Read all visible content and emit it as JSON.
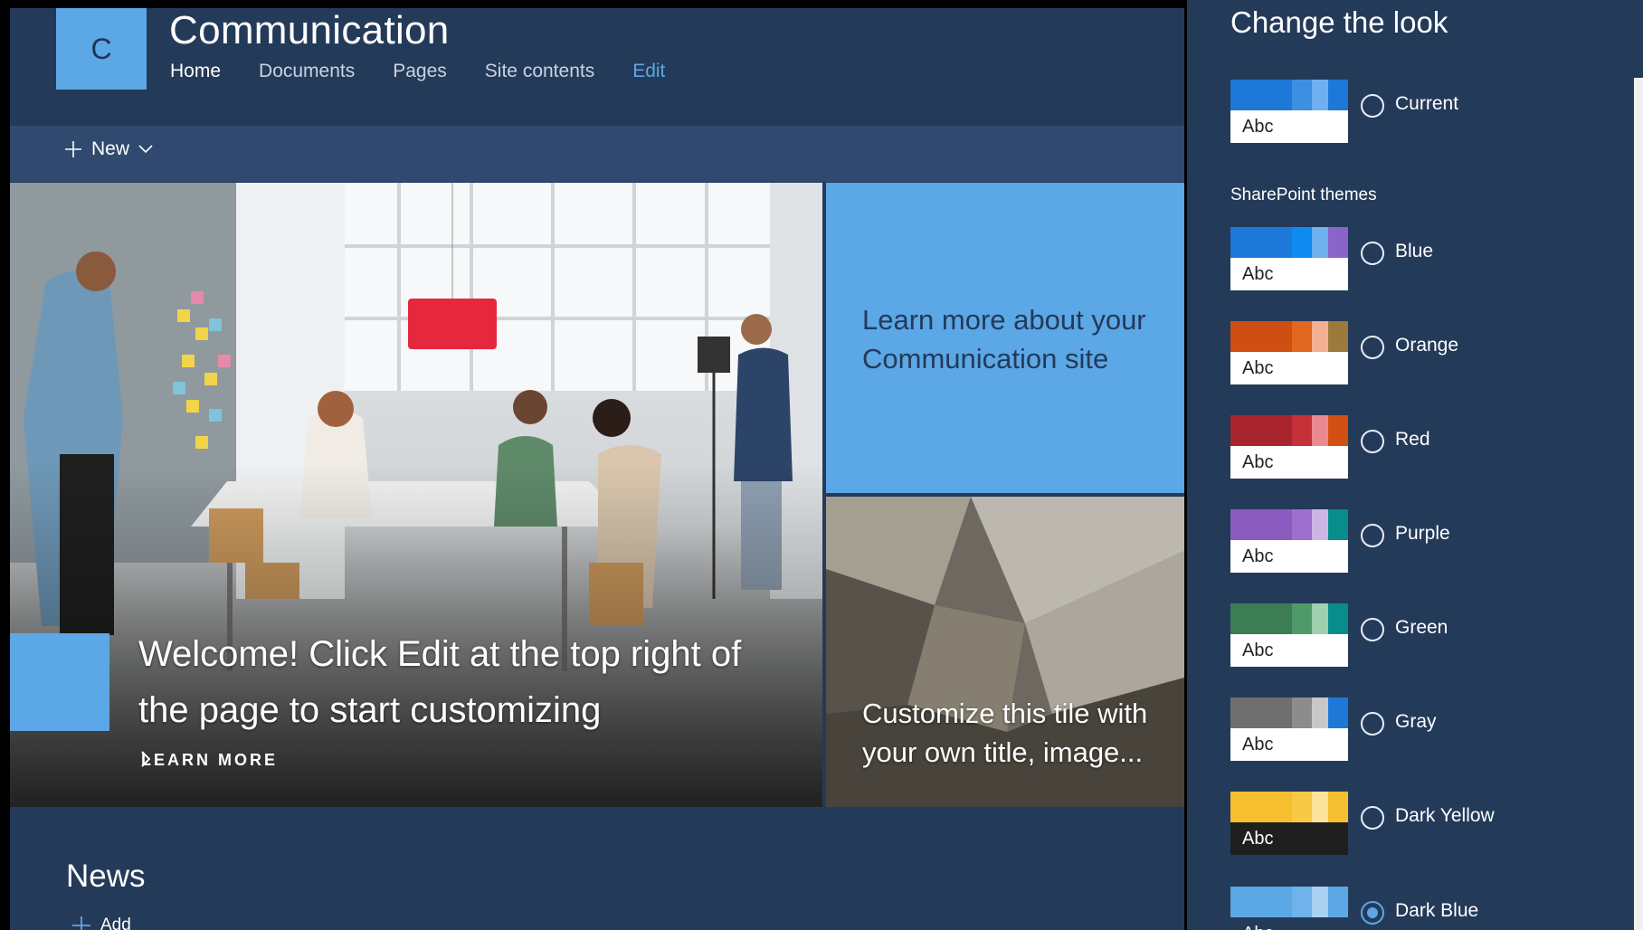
{
  "site": {
    "logo_letter": "C",
    "title": "Communication",
    "nav": [
      {
        "label": "Home",
        "state": "active"
      },
      {
        "label": "Documents",
        "state": ""
      },
      {
        "label": "Pages",
        "state": ""
      },
      {
        "label": "Site contents",
        "state": ""
      },
      {
        "label": "Edit",
        "state": "edit"
      }
    ],
    "new_label": "New"
  },
  "hero": {
    "main_title": "Welcome! Click Edit at the top right of the page to start customizing",
    "learn_more": "LEARN MORE",
    "tile_top_text": "Learn more about your Communication site",
    "tile_bottom_text": "Customize this tile with your own title, image..."
  },
  "news": {
    "title": "News",
    "add_label": "Add"
  },
  "panel": {
    "title": "Change the look",
    "section_label": "SharePoint themes",
    "themes": [
      {
        "name": "Current",
        "checked": false,
        "colors": [
          "#1e78d8",
          "#1e78d8",
          "#3d8fe2",
          "#6fb0f0",
          "#1e78d8"
        ],
        "bottom_bg": "#ffffff",
        "bottom_fg": "#222222"
      },
      {
        "name": "Blue",
        "checked": false,
        "colors": [
          "#1e78d8",
          "#1e78d8",
          "#0e8af0",
          "#6fb0f0",
          "#8a64c8"
        ],
        "bottom_bg": "#ffffff",
        "bottom_fg": "#222222"
      },
      {
        "name": "Orange",
        "checked": false,
        "colors": [
          "#cf4f12",
          "#cf4f12",
          "#e06820",
          "#f4b090",
          "#9b7a3c"
        ],
        "bottom_bg": "#ffffff",
        "bottom_fg": "#222222"
      },
      {
        "name": "Red",
        "checked": false,
        "colors": [
          "#a8252d",
          "#a8252d",
          "#c63038",
          "#ec8890",
          "#d25012"
        ],
        "bottom_bg": "#ffffff",
        "bottom_fg": "#222222"
      },
      {
        "name": "Purple",
        "checked": false,
        "colors": [
          "#8a5cc0",
          "#8a5cc0",
          "#9c70cc",
          "#cdb6e6",
          "#098c8c"
        ],
        "bottom_bg": "#ffffff",
        "bottom_fg": "#222222"
      },
      {
        "name": "Green",
        "checked": false,
        "colors": [
          "#3c7d54",
          "#3c7d54",
          "#4f9a68",
          "#9fd0af",
          "#098c8c"
        ],
        "bottom_bg": "#ffffff",
        "bottom_fg": "#222222"
      },
      {
        "name": "Gray",
        "checked": false,
        "colors": [
          "#6f6f6f",
          "#6f6f6f",
          "#8c8c8c",
          "#c8c8c8",
          "#1e78d8"
        ],
        "bottom_bg": "#ffffff",
        "bottom_fg": "#222222"
      },
      {
        "name": "Dark Yellow",
        "checked": false,
        "colors": [
          "#f5bf30",
          "#f5bf30",
          "#f7c944",
          "#fbe39a",
          "#f5bf30"
        ],
        "bottom_bg": "#1f1f1f",
        "bottom_fg": "#ffffff"
      },
      {
        "name": "Dark Blue",
        "checked": true,
        "colors": [
          "#5ca7e6",
          "#5ca7e6",
          "#6fb3ea",
          "#a9d1f2",
          "#5ca7e6"
        ],
        "bottom_bg": "#243a59",
        "bottom_fg": "#ffffff"
      }
    ]
  }
}
